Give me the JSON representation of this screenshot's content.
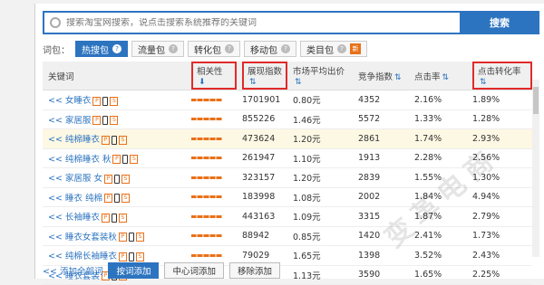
{
  "search": {
    "placeholder": "搜索淘宝网搜索，说点击搜索系统推荐的关键词",
    "button": "搜索"
  },
  "word_packs": {
    "label": "词包：",
    "tabs": [
      {
        "label": "热搜包",
        "active": true
      },
      {
        "label": "流量包"
      },
      {
        "label": "转化包"
      },
      {
        "label": "移动包"
      },
      {
        "label": "类目包",
        "new": "新"
      }
    ]
  },
  "table": {
    "headers": {
      "keyword": "关键词",
      "relevance": "相关性",
      "impression": "展现指数",
      "market_avg_bid": "市场平均出价",
      "competition": "竞争指数",
      "ctr": "点击率",
      "conversion": "点击转化率"
    },
    "rows": [
      {
        "keyword": "女睡衣",
        "impression": "1701901",
        "bid": "0.80元",
        "competition": "4352",
        "ctr": "2.16%",
        "conv": "1.89%"
      },
      {
        "keyword": "家居服",
        "impression": "855226",
        "bid": "1.46元",
        "competition": "5572",
        "ctr": "1.33%",
        "conv": "1.28%"
      },
      {
        "keyword": "纯棉睡衣",
        "impression": "473624",
        "bid": "1.20元",
        "competition": "2861",
        "ctr": "1.74%",
        "conv": "2.93%"
      },
      {
        "keyword": "纯棉睡衣 秋",
        "impression": "261947",
        "bid": "1.10元",
        "competition": "1913",
        "ctr": "2.28%",
        "conv": "2.56%"
      },
      {
        "keyword": "家居服 女",
        "impression": "323157",
        "bid": "1.20元",
        "competition": "2839",
        "ctr": "1.55%",
        "conv": "1.30%"
      },
      {
        "keyword": "睡衣 纯棉",
        "impression": "183998",
        "bid": "1.08元",
        "competition": "2002",
        "ctr": "1.84%",
        "conv": "4.94%"
      },
      {
        "keyword": "长袖睡衣",
        "impression": "443163",
        "bid": "1.09元",
        "competition": "3315",
        "ctr": "1.87%",
        "conv": "2.79%"
      },
      {
        "keyword": "睡衣女套装秋",
        "impression": "88942",
        "bid": "0.85元",
        "competition": "1420",
        "ctr": "2.41%",
        "conv": "1.73%"
      },
      {
        "keyword": "纯棉长袖睡衣",
        "impression": "79029",
        "bid": "1.65元",
        "competition": "1398",
        "ctr": "3.52%",
        "conv": "2.43%"
      },
      {
        "keyword": "睡衣套装",
        "impression": "415260",
        "bid": "1.13元",
        "competition": "3590",
        "ctr": "1.65%",
        "conv": "2.25%"
      }
    ]
  },
  "footer": {
    "back": "<< 添加全部词",
    "btn1": "按词添加",
    "btn2": "中心词添加",
    "btn3": "移除添加"
  },
  "watermark": "变革电商"
}
